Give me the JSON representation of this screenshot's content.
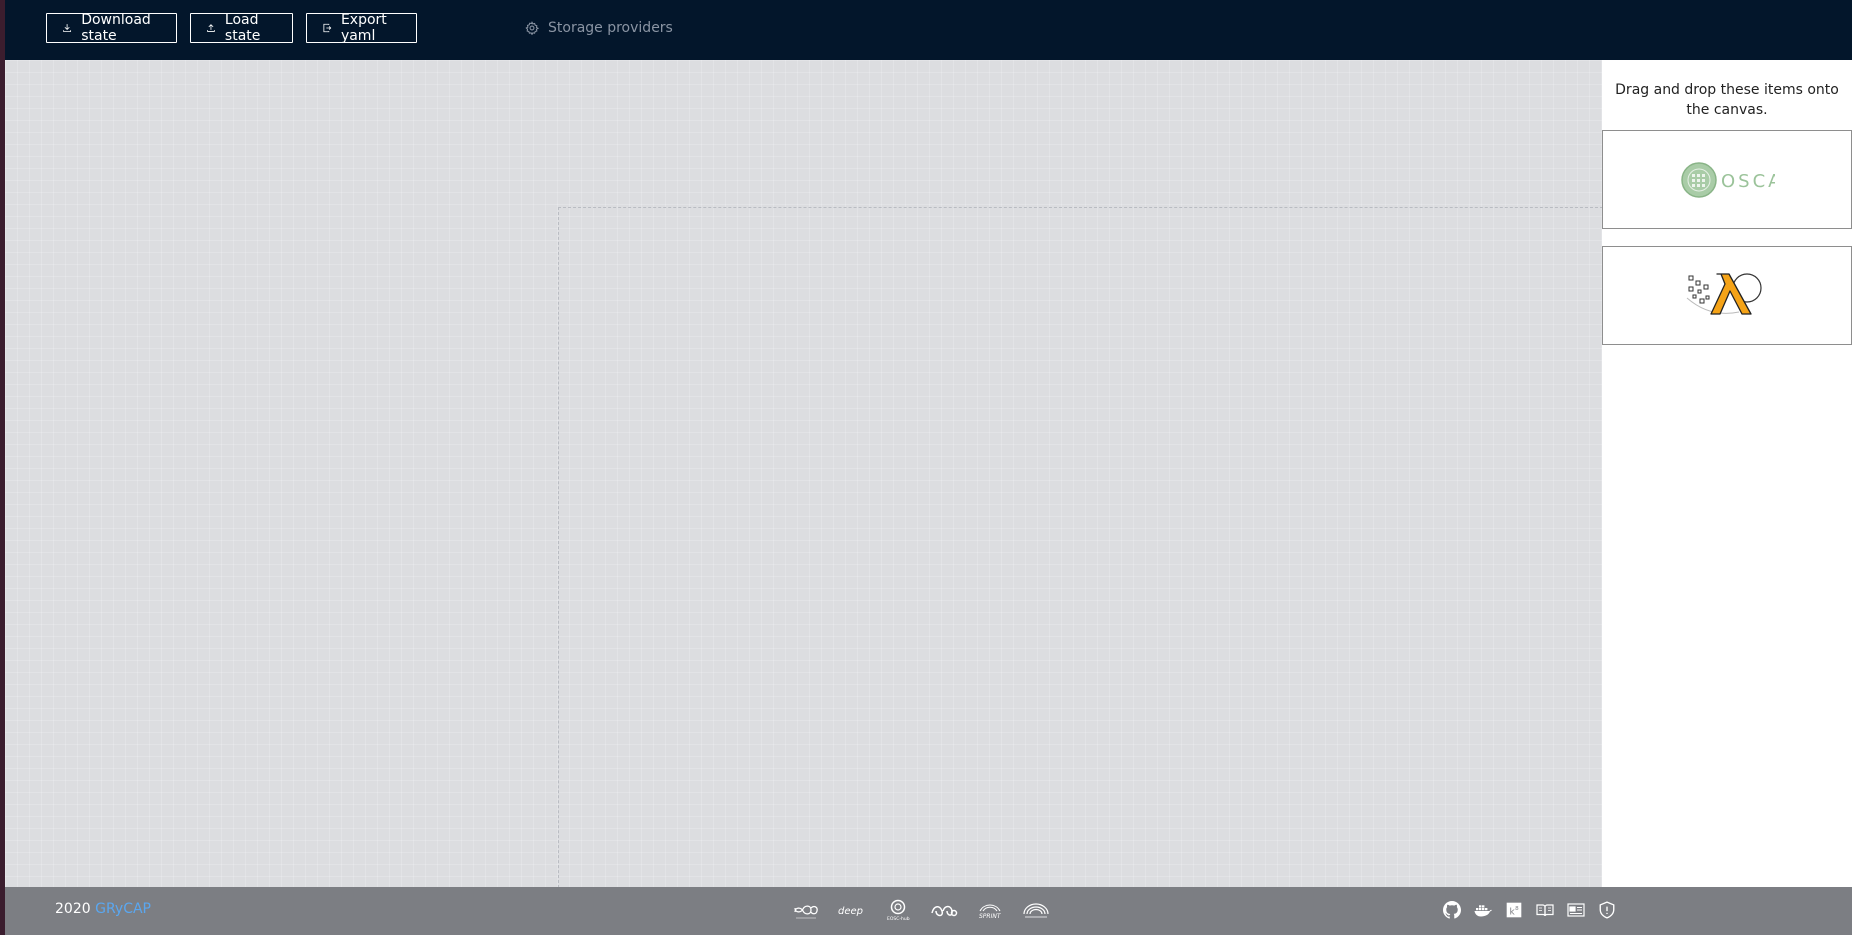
{
  "toolbar": {
    "download_label": "Download state",
    "load_label": "Load state",
    "export_label": "Export yaml",
    "storage_label": "Storage providers"
  },
  "panel": {
    "title": "Drag and drop these items onto the canvas.",
    "items": [
      {
        "name": "OSCAR",
        "logo_text": "OSCAR"
      },
      {
        "name": "AWS Lambda"
      }
    ]
  },
  "footer": {
    "year": "2020",
    "org": "GRyCAP",
    "partners": [
      "ai4eosc",
      "deep",
      "eosc-hub",
      "egi",
      "sprint",
      "upv"
    ],
    "icons": [
      "github-icon",
      "docker-icon",
      "k8s-icon",
      "docs-icon",
      "blog-icon",
      "privacy-icon"
    ]
  },
  "colors": {
    "topbar": "#03162b",
    "canvas": "#dcdde0",
    "footer": "#7c7e83",
    "link": "#5aa7f0",
    "oscar_green": "#9bc39a",
    "lambda_orange": "#f5a317"
  }
}
